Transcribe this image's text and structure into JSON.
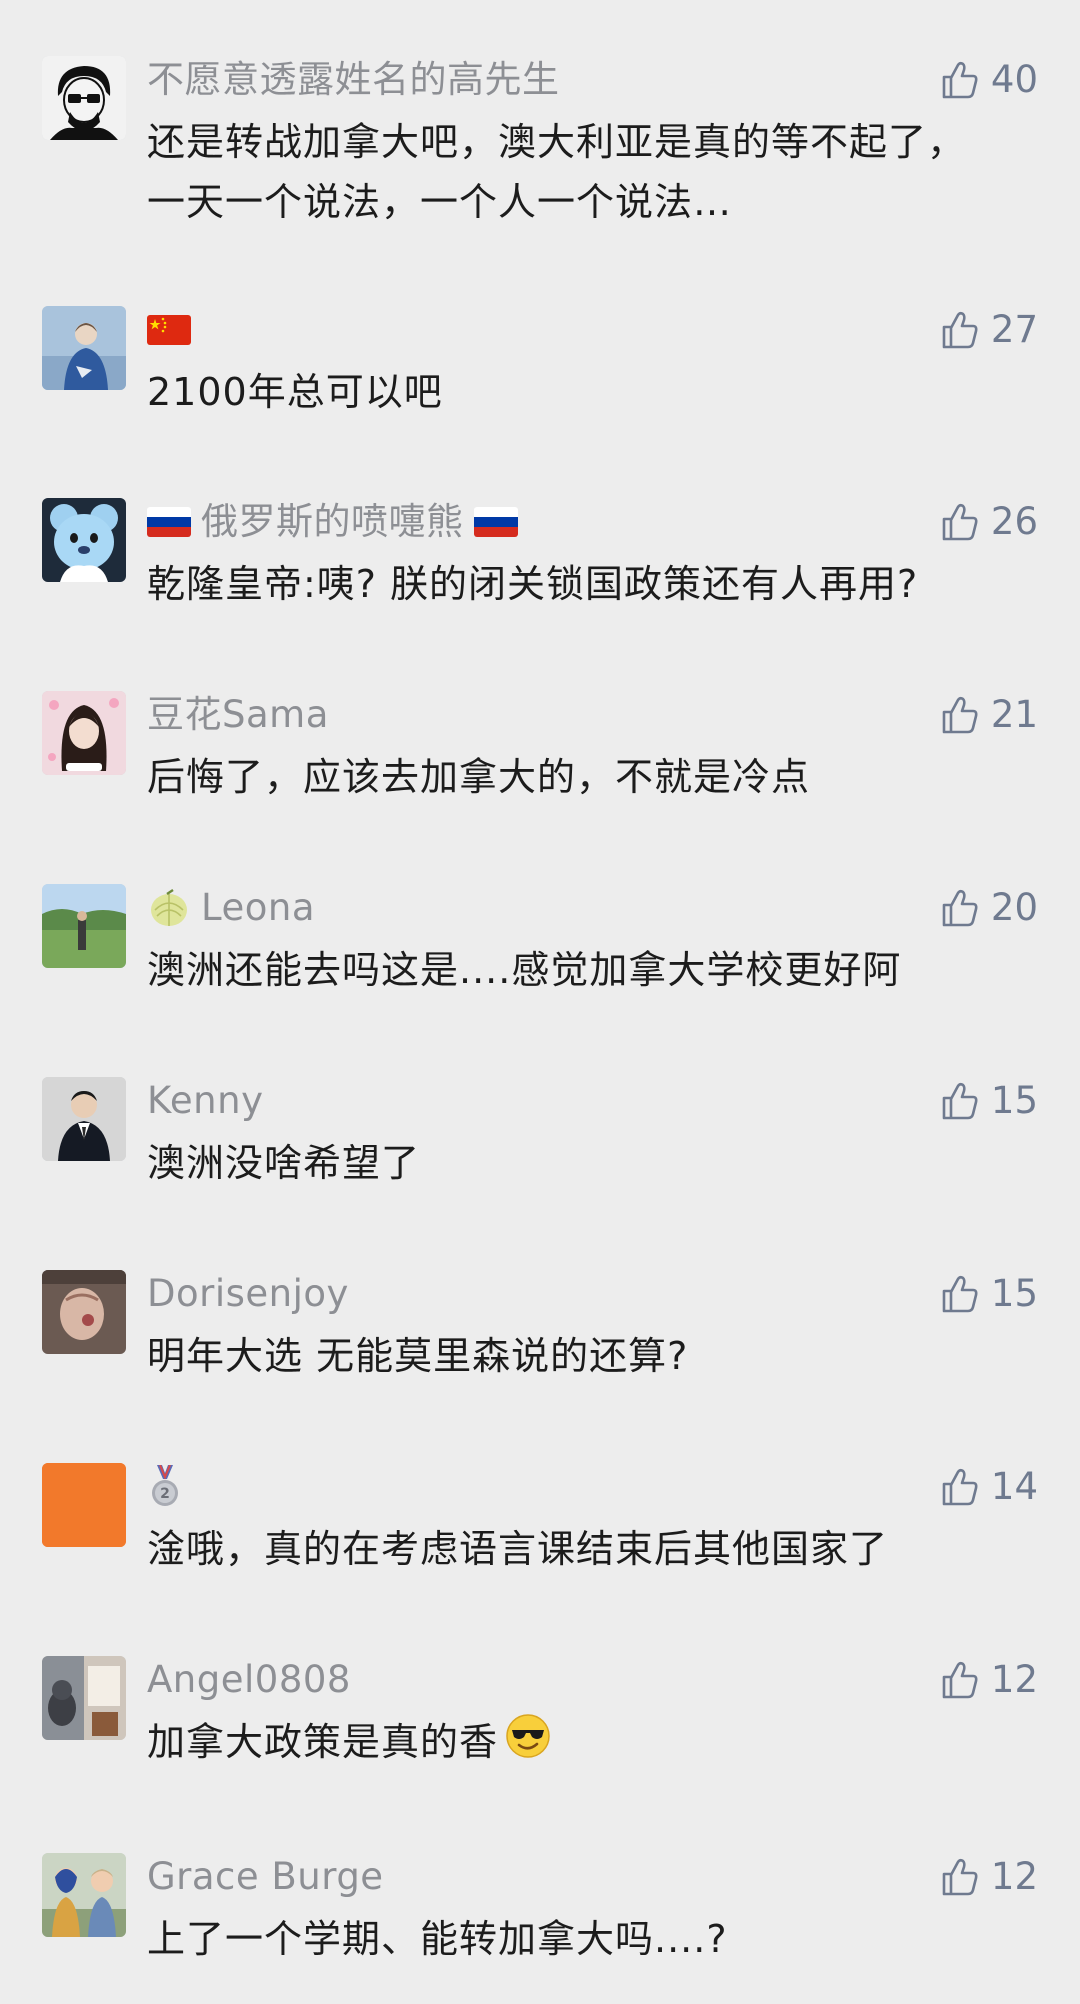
{
  "comments": [
    {
      "nickname": "不愿意透露姓名的高先生",
      "text": "还是转战加拿大吧，澳大利亚是真的等不起了，一天一个说法，一个人一个说法…",
      "likes": "40"
    },
    {
      "nickname": "",
      "flag": "china-flag",
      "text": "2100年总可以吧",
      "likes": "27"
    },
    {
      "nickname": "俄罗斯的喷嚏熊",
      "flag": "russia-flag",
      "text": "乾隆皇帝:咦? 朕的闭关锁国政策还有人再用?",
      "likes": "26"
    },
    {
      "nickname": "豆花Sama",
      "text": "后悔了，应该去加拿大的，不就是冷点",
      "likes": "21"
    },
    {
      "nickname": "Leona",
      "icon": "melon-icon",
      "text": "澳洲还能去吗这是....感觉加拿大学校更好阿",
      "likes": "20"
    },
    {
      "nickname": "Kenny",
      "text": "澳洲没啥希望了",
      "likes": "15"
    },
    {
      "nickname": "Dorisenjoy",
      "text": "明年大选 无能莫里森说的还算?",
      "likes": "15"
    },
    {
      "nickname": "",
      "icon": "medal-icon",
      "text": "淦哦，真的在考虑语言课结束后其他国家了",
      "likes": "14"
    },
    {
      "nickname": "Angel0808",
      "text": "加拿大政策是真的香",
      "emoji": "sunglasses-emoji",
      "likes": "12"
    },
    {
      "nickname": "Grace Burge",
      "text": "上了一个学期、能转加拿大吗....?",
      "likes": "12"
    }
  ],
  "colors": {
    "background": "#ededed",
    "nickname": "#8d8f94",
    "text": "#1c1c1c",
    "like": "#6f7a8f"
  }
}
